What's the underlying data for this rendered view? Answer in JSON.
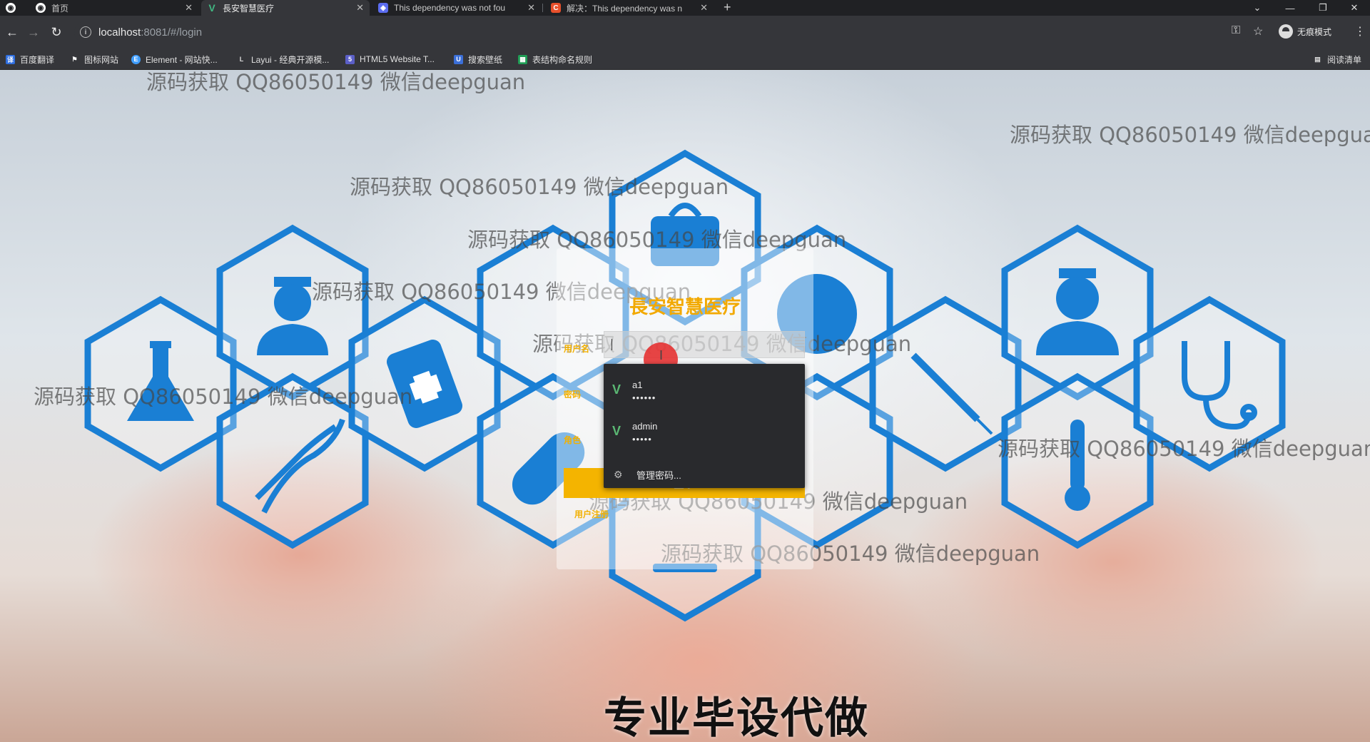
{
  "browser": {
    "tabs": [
      {
        "title": "首页",
        "active": false,
        "favicon": "globe-icon"
      },
      {
        "title": "長安智慧医疗",
        "active": true,
        "favicon": "vue-icon"
      },
      {
        "title": "This dependency was not fou",
        "active": false,
        "favicon": "doc-icon"
      },
      {
        "title": "解决：This dependency was n",
        "active": false,
        "favicon": "csdn-icon"
      }
    ],
    "url_host": "localhost",
    "url_path": ":8081/#/login",
    "profile_label": "无痕模式",
    "bookmarks": [
      {
        "label": "百度翻译",
        "icon": "translate-icon",
        "color": "#2f6fe0"
      },
      {
        "label": "图标网站",
        "icon": "flag-icon",
        "color": "#555555"
      },
      {
        "label": "Element - 网站快...",
        "icon": "element-icon",
        "color": "#409eff"
      },
      {
        "label": "Layui - 经典开源模...",
        "icon": "layui-icon",
        "color": "#555555"
      },
      {
        "label": "HTML5 Website T...",
        "icon": "html5-icon",
        "color": "#5b5fc7"
      },
      {
        "label": "搜索壁纸",
        "icon": "wallpaper-icon",
        "color": "#3b6fd8"
      },
      {
        "label": "表结构命名规则",
        "icon": "sheet-icon",
        "color": "#1f9d55"
      }
    ],
    "reading_list": "阅读清单"
  },
  "login": {
    "title": "長安智慧医疗",
    "username_label": "用户名",
    "password_label": "密码",
    "role_label": "角色",
    "login_button": "登录",
    "register_link": "用户注册"
  },
  "autofill": {
    "items": [
      {
        "username": "a1",
        "password": "••••••"
      },
      {
        "username": "admin",
        "password": "•••••"
      }
    ],
    "manage_label": "管理密码..."
  },
  "watermark": "源码获取 QQ86050149 微信deepguan",
  "banner": "专业毕设代做",
  "colors": {
    "accent": "#f4b400",
    "hex_icon": "#1a7fd4",
    "browser_dark": "#202124"
  }
}
